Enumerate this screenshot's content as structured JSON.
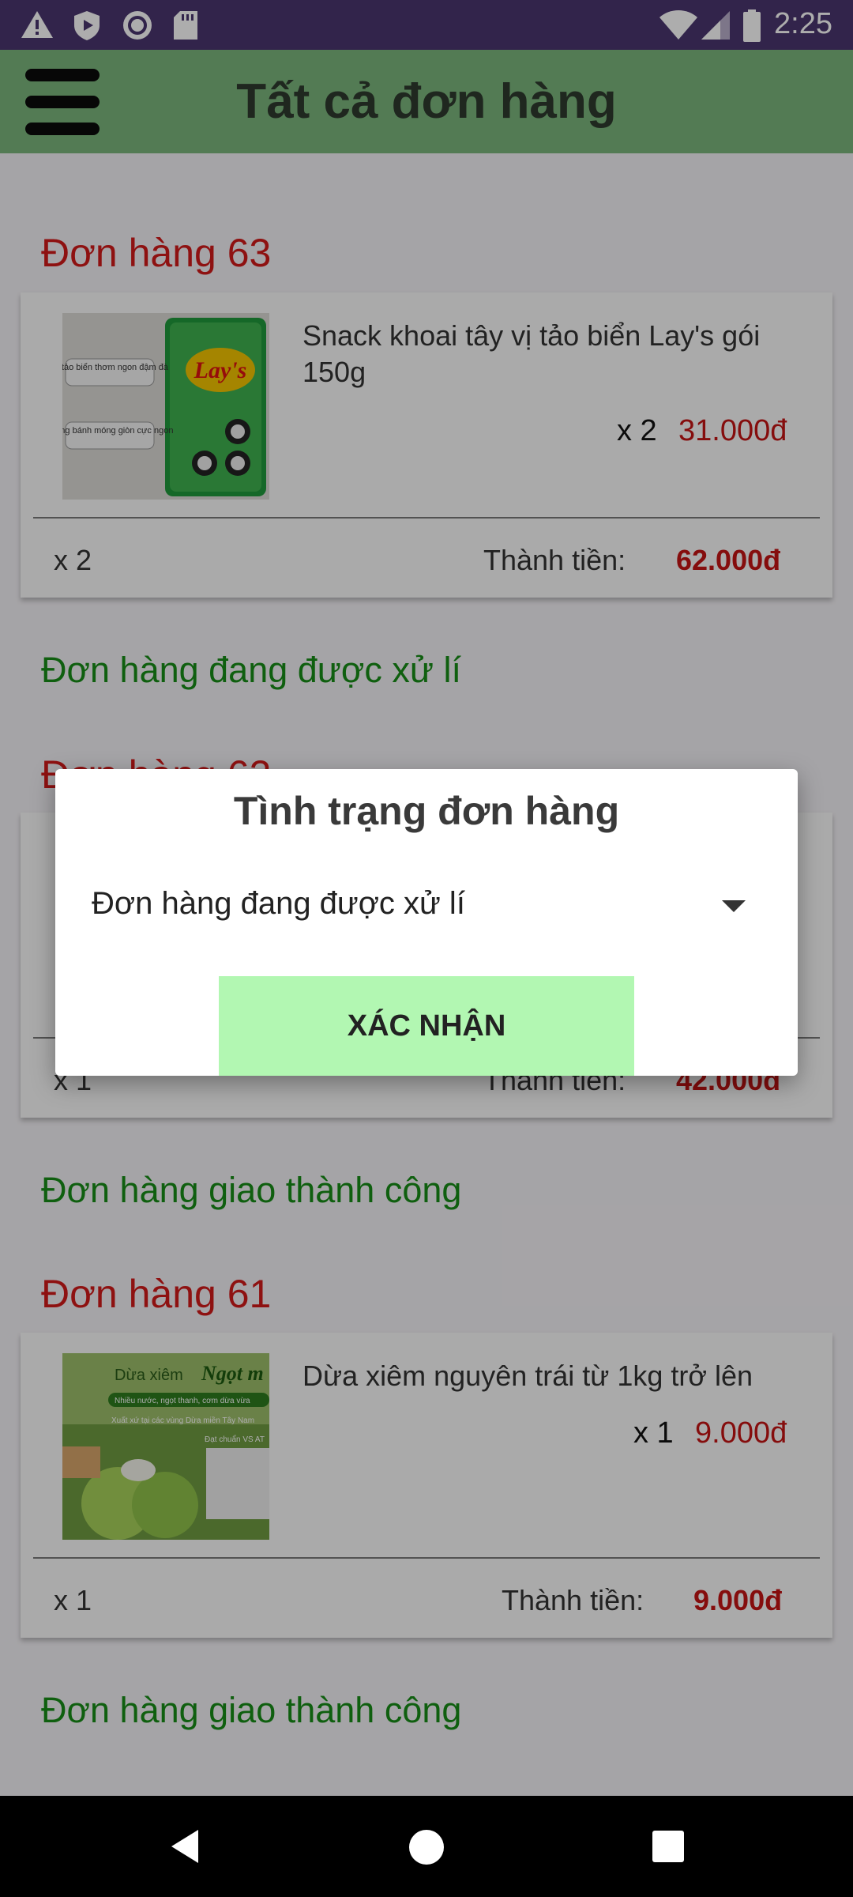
{
  "status_bar": {
    "time": "2:25",
    "icons": [
      "warning-icon",
      "shield-play-icon",
      "record-icon",
      "sd-card-icon",
      "wifi-icon",
      "signal-icon",
      "battery-icon"
    ]
  },
  "toolbar": {
    "title": "Tất cả đơn hàng",
    "menu_icon": "hamburger-menu-icon"
  },
  "orders": [
    {
      "title": "Đơn hàng 63",
      "product_name": "Snack khoai tây vị tảo biển Lay's gói 150g",
      "qty": "x 2",
      "unit_price": "31.000đ",
      "foot_qty": "x 2",
      "total_label": "Thành tiền:",
      "total": "62.000đ",
      "status": "Đơn hàng đang được xử lí",
      "thumb_text": [
        "Vị tảo biển thơm ngon đậm đà",
        "Miếng bánh móng giòn cực ngon",
        "Lay's"
      ]
    },
    {
      "title": "Đơn hàng 62",
      "foot_qty": "x 1",
      "total_label": "Thành tiền:",
      "total": "42.000đ",
      "status": "Đơn hàng giao thành công"
    },
    {
      "title": "Đơn hàng 61",
      "product_name": "Dừa xiêm nguyên trái từ 1kg trở lên",
      "qty": "x 1",
      "unit_price": "9.000đ",
      "foot_qty": "x 1",
      "total_label": "Thành tiền:",
      "total": "9.000đ",
      "status": "Đơn hàng giao thành công",
      "thumb_text": [
        "Dừa xiêm",
        "Ngọt m",
        "Nhiều nước, ngọt thanh, cơm dừa vừa",
        "Xuất xứ tại các vùng Dừa miền Tây Nam",
        "Đạt chuẩn VS AT"
      ]
    }
  ],
  "dialog": {
    "title": "Tình trạng đơn hàng",
    "selected_status": "Đơn hàng đang được xử lí",
    "confirm_label": "XÁC NHẬN"
  },
  "colors": {
    "status_bar": "#4a356f",
    "toolbar": "#7bb67c",
    "order_title": "#d11a1a",
    "status_green": "#178c17",
    "confirm_button": "#b2f7b2"
  }
}
